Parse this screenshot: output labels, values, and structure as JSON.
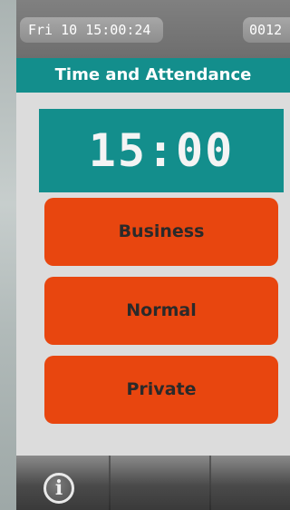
{
  "status": {
    "datetime": "Fri 10  15:00:24",
    "counter": "0012"
  },
  "header": {
    "title": "Time and Attendance"
  },
  "clock": {
    "time": "15:00"
  },
  "actions": [
    {
      "label": "Business"
    },
    {
      "label": "Normal"
    },
    {
      "label": "Private"
    }
  ],
  "footer": {
    "info_icon": "info-icon",
    "info_glyph": "i"
  },
  "colors": {
    "accent": "#138e8c",
    "action": "#e8460f",
    "status_bar": "#6e6e6e"
  }
}
